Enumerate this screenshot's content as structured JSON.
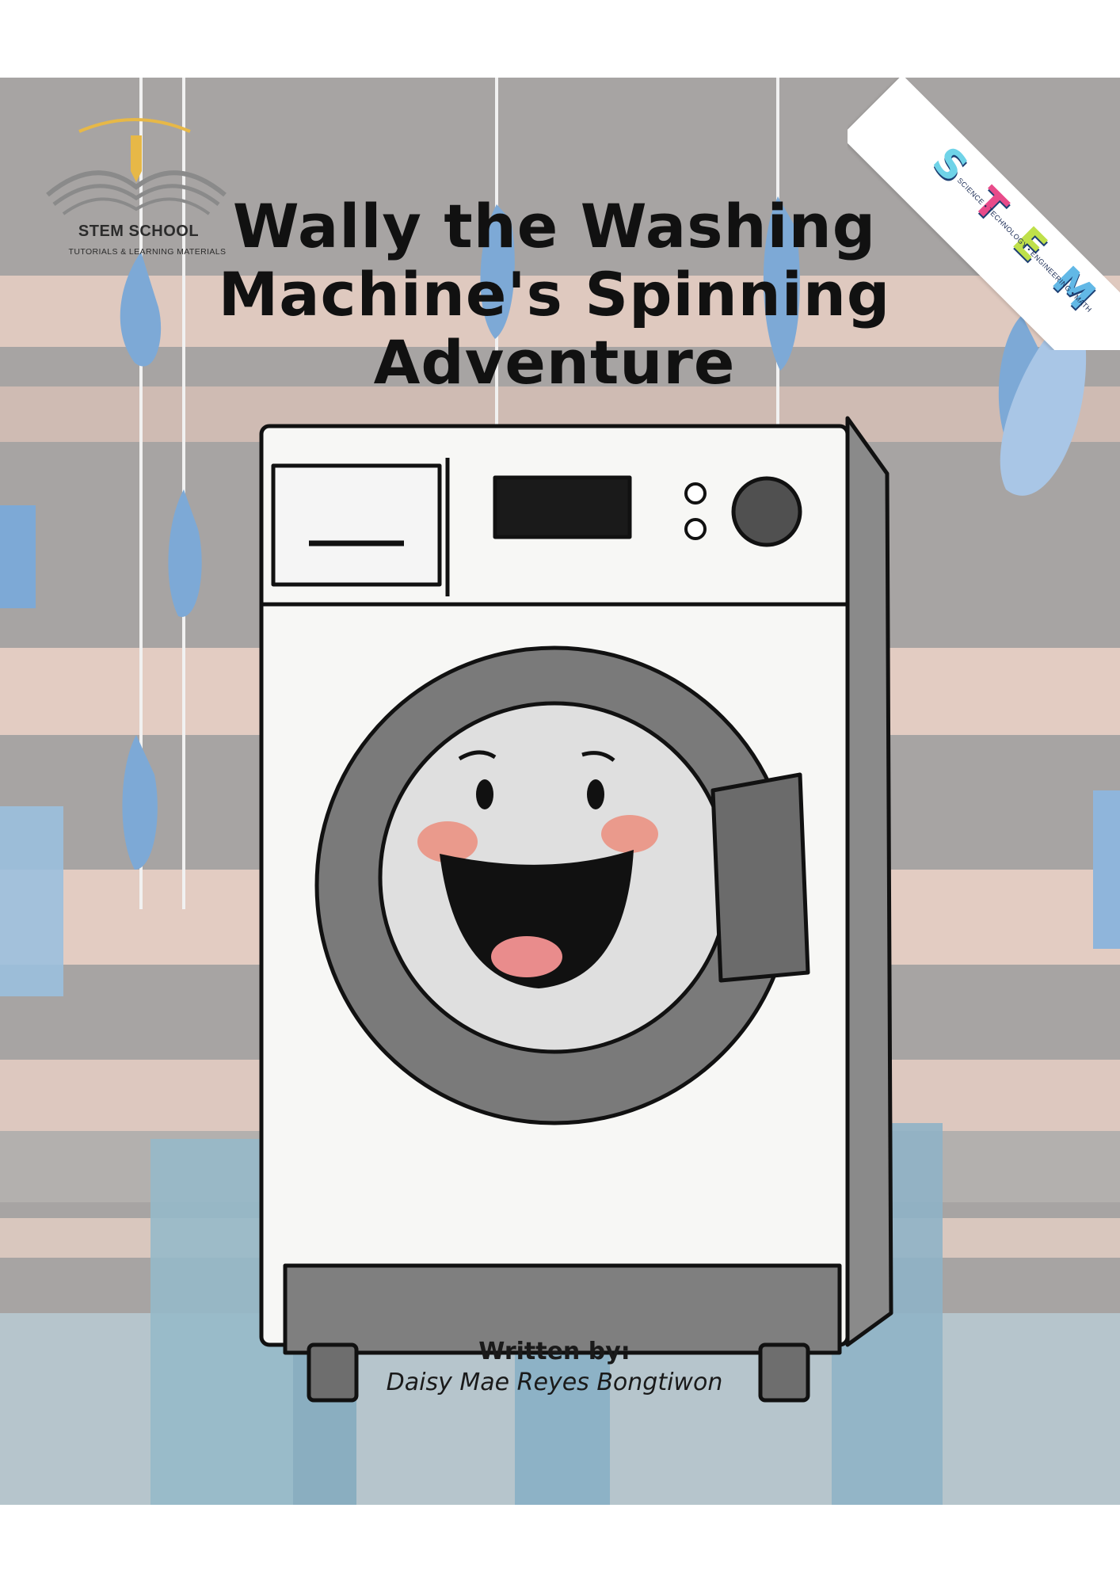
{
  "logo": {
    "name": "STEM SCHOOL",
    "tagline": "TUTORIALS & LEARNING MATERIALS"
  },
  "title": {
    "line1": "Wally the Washing",
    "line2": "Machine's Spinning",
    "line3": "Adventure"
  },
  "byline": {
    "label": "Written by:",
    "author": "Daisy Mae Reyes Bongtiwon"
  },
  "stem_badge": {
    "letters": [
      "S",
      "T",
      "E",
      "M"
    ],
    "subtitle": "SCIENCE • TECHNOLOGY • ENGINEERING • MATH",
    "colors": [
      "#6fd3e8",
      "#e84b8a",
      "#bfe04a",
      "#62b8e6"
    ]
  },
  "colors": {
    "background_gray": "#a9a5a3",
    "background_pink": "#e6cfc4",
    "drip_blue": "#7da9d6",
    "machine_white": "#f7f7f5",
    "drum_gray": "#7b7b7b",
    "cheek_pink": "#ea9a8c"
  }
}
